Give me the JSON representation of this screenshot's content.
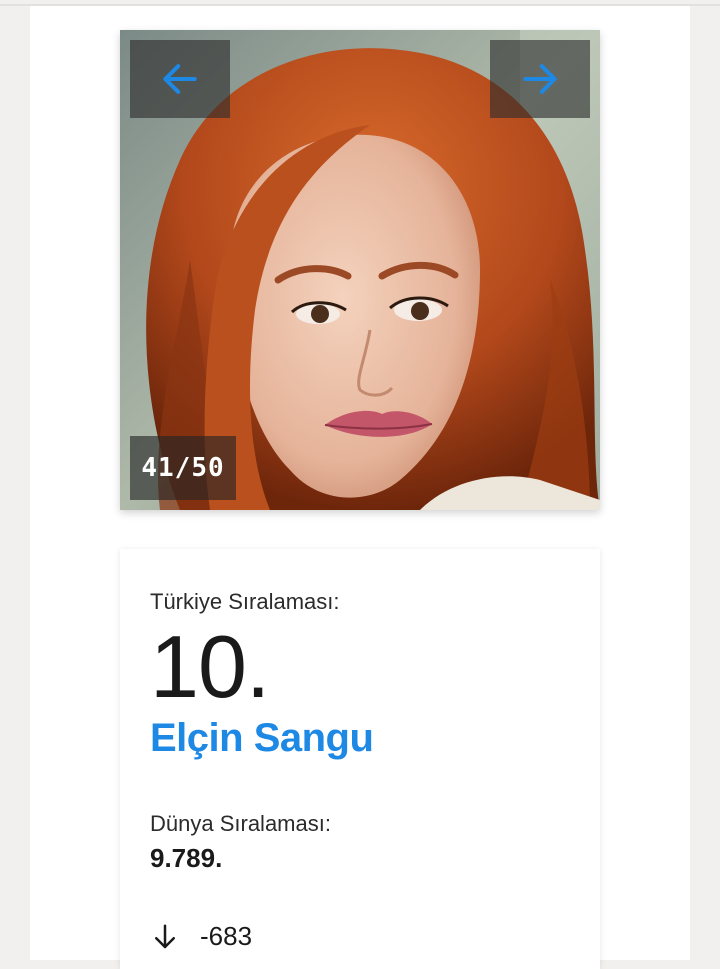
{
  "gallery": {
    "counter": "41/50",
    "photo_icon": "portrait-photo",
    "prev_icon": "arrow-left-icon",
    "next_icon": "arrow-right-icon",
    "accent_color": "#1e88e5"
  },
  "ranking": {
    "turkey_label": "Türkiye Sıralaması:",
    "turkey_rank": "10.",
    "name": "Elçin Sangu",
    "world_label": "Dünya Sıralaması:",
    "world_rank": "9.789.",
    "change_icon": "arrow-down-icon",
    "change_value": "-683"
  }
}
